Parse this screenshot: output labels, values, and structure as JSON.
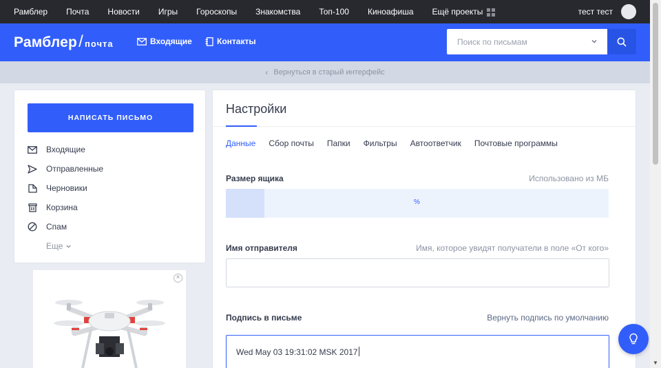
{
  "topbar": {
    "links": [
      "Рамблер",
      "Почта",
      "Новости",
      "Игры",
      "Гороскопы",
      "Знакомства",
      "Топ-100",
      "Киноафиша",
      "Ещё проекты"
    ],
    "user_name": "тест тест"
  },
  "header": {
    "logo_main": "Рамблер",
    "logo_slash": "/",
    "logo_sub": "почта",
    "nav_inbox": "Входящие",
    "nav_contacts": "Контакты",
    "search_placeholder": "Поиск по письмам"
  },
  "back_link": "Вернуться в старый интерфейс",
  "sidebar": {
    "compose_label": "НАПИСАТЬ ПИСЬМО",
    "folders": [
      {
        "label": "Входящие",
        "icon": "envelope-icon"
      },
      {
        "label": "Отправленные",
        "icon": "paper-plane-icon"
      },
      {
        "label": "Черновики",
        "icon": "draft-icon"
      },
      {
        "label": "Корзина",
        "icon": "trash-icon"
      },
      {
        "label": "Спам",
        "icon": "spam-icon"
      }
    ],
    "more_label": "Еще"
  },
  "settings": {
    "title": "Настройки",
    "tabs": [
      "Данные",
      "Сбор почты",
      "Папки",
      "Фильтры",
      "Автоответчик",
      "Почтовые программы"
    ],
    "active_tab": "Данные",
    "mailbox_size_label": "Размер ящика",
    "usage_text": "Использовано из МБ",
    "usage_percent_text": "%",
    "usage_fraction": 0.1,
    "sender_name_label": "Имя отправителя",
    "sender_name_hint": "Имя, которое увидят получатели в поле «От кого»",
    "sender_name_value": "",
    "signature_label": "Подпись в письме",
    "signature_reset": "Вернуть подпись по умолчанию",
    "signature_value": "Wed May 03 19:31:02 MSK 2017"
  },
  "colors": {
    "accent": "#315efb",
    "topbar_bg": "#27292f"
  }
}
